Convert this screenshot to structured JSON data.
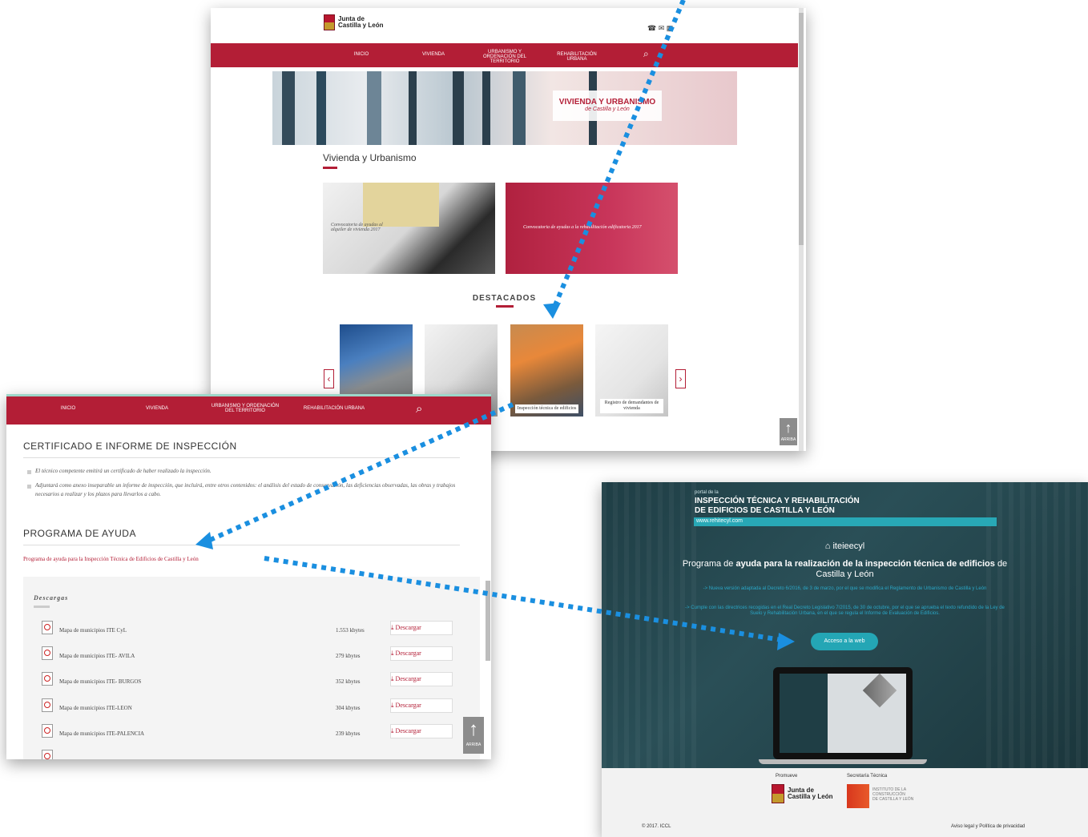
{
  "screenshot1": {
    "logo": {
      "line1": "Junta de",
      "line2": "Castilla y León"
    },
    "header_icons": [
      "phone-icon",
      "mail-icon",
      "grid-icon"
    ],
    "nav": [
      {
        "label": "INICIO"
      },
      {
        "label": "VIVIENDA"
      },
      {
        "label": "URBANISMO Y ORDENACIÓN DEL TERRITORIO"
      },
      {
        "label": "REHABILITACIÓN URBANA"
      }
    ],
    "hero": {
      "title": "VIVIENDA Y URBANISMO",
      "subtitle": "de Castilla y León"
    },
    "section_title": "Vivienda y Urbanismo",
    "cards": [
      {
        "label": "Convocatoria de ayudas al alquiler de vivienda 2017"
      },
      {
        "label": "Convocatoria de ayudas a la rehabilitación edificatoria 2017"
      }
    ],
    "destacados_title": "DESTACADOS",
    "thumbs": [
      {
        "caption": ""
      },
      {
        "caption": ""
      },
      {
        "caption": "Inspección técnica de edificios"
      },
      {
        "caption": "Registro de demandantes de vivienda"
      }
    ],
    "arriba_label": "ARRIBA"
  },
  "screenshot2": {
    "nav": [
      {
        "label": "INICIO"
      },
      {
        "label": "VIVIENDA"
      },
      {
        "label": "URBANISMO Y ORDENACIÓN DEL TERRITORIO"
      },
      {
        "label": "REHABILITACIÓN URBANA"
      }
    ],
    "cert_title": "CERTIFICADO E INFORME DE INSPECCIÓN",
    "cert_p1": "El técnico competente emitirá un certificado de haber realizado la inspección.",
    "cert_p2": "Adjuntará como anexo inseparable un informe de inspección, que incluirá, entre otros contenidos: el análisis del estado de conservación, las deficiencias observadas, las obras y trabajos necesarios a realizar y los plazos para llevarlos a cabo.",
    "programa_title": "PROGRAMA DE AYUDA",
    "programa_link": "Programa de ayuda para la Inspección Técnica de Edificios de Castilla y León",
    "descargas_title": "Descargas",
    "download_label": "Descargar",
    "downloads": [
      {
        "name": "Mapa de municipios ITE CyL",
        "size": "1.553 kbytes"
      },
      {
        "name": "Mapa de municipios ITE- AVILA",
        "size": "279 kbytes"
      },
      {
        "name": "Mapa de municipios ITE- BURGOS",
        "size": "352 kbytes"
      },
      {
        "name": "Mapa de municipios ITE-LEON",
        "size": "304 kbytes"
      },
      {
        "name": "Mapa de municipios ITE-PALENCIA",
        "size": "239 kbytes"
      }
    ],
    "arriba_label": "ARRIBA"
  },
  "screenshot3": {
    "portal_small": "portal de la",
    "portal_title1": "INSPECCIÓN TÉCNICA Y REHABILITACIÓN",
    "portal_title2": "DE EDIFICIOS DE CASTILLA Y LEÓN",
    "portal_url": "www.rehitecyl.com",
    "brand": "iteieecyl",
    "headline_pre": "Programa de",
    "headline_bold": "ayuda para la realización de la inspección técnica de edificios",
    "headline_post": "de Castilla y León",
    "bullet1": "-> Nueva versión adaptada al Decreto 6/2016, de 3 de marzo, por el que se modifica el Reglamento de Urbanismo de Castilla y León",
    "bullet2": "-> Cumple con las directrices recogidas en el Real Decreto Legislativo 7/2015, de 30 de octubre, por el que se aprueba el texto refundido de la Ley de Suelo y Rehabilitación Urbana, en el que se regula el Informe de Evaluación de Edificios.",
    "button": "Acceso a la web",
    "promueve": "Promueve",
    "secretaria": "Secretaría Técnica",
    "junta": "Junta de Castilla y León",
    "iccl1": "INSTITUTO DE LA",
    "iccl2": "CONSTRUCCIÓN",
    "iccl3": "DE CASTILLA Y LEÓN",
    "copyright": "© 2017. ICCL",
    "legal": "Aviso legal y Política de privacidad"
  },
  "colors": {
    "brand_red": "#b31e36",
    "teal": "#24a6b5",
    "dark_bg": "#1f3e45",
    "arrow_blue": "#1a8fe0"
  }
}
